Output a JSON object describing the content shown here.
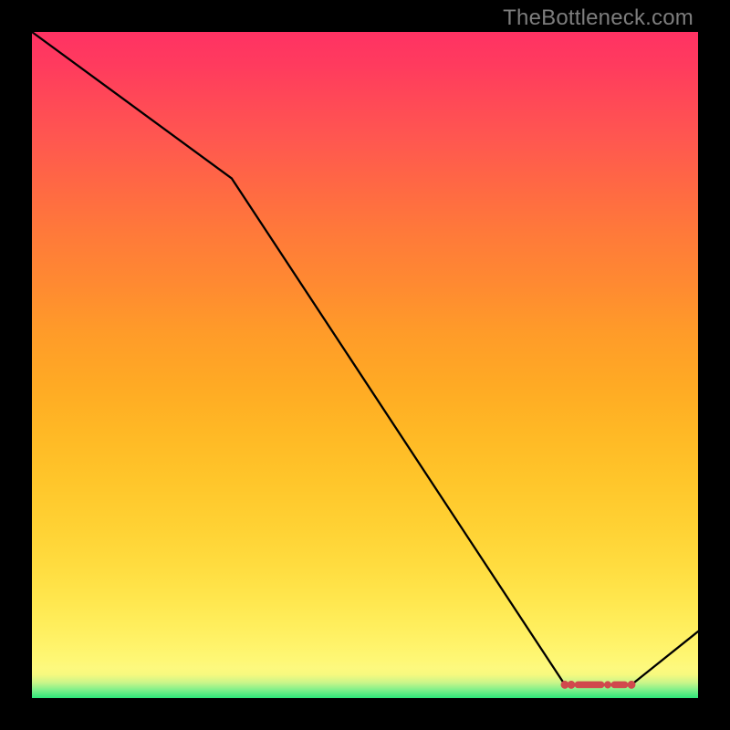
{
  "watermark": "TheBottleneck.com",
  "chart_data": {
    "type": "line",
    "title": "",
    "xlabel": "",
    "ylabel": "",
    "xlim": [
      0,
      100
    ],
    "ylim": [
      0,
      100
    ],
    "x": [
      0,
      30,
      80,
      90,
      100
    ],
    "values": [
      100,
      78,
      2,
      2,
      10
    ],
    "flat_region": {
      "x_start": 80,
      "x_end": 90,
      "y": 2
    },
    "markers": {
      "x": [
        80,
        81,
        82,
        83.5,
        85.2,
        86.5,
        88,
        90
      ],
      "y": [
        2,
        2,
        2,
        2,
        2,
        2,
        2,
        2
      ]
    },
    "gradient_scale": {
      "bottom_color": "#2ee87a",
      "top_color": "#ff3263",
      "stops": [
        "green",
        "yellow",
        "orange",
        "red",
        "pink-red"
      ]
    }
  }
}
